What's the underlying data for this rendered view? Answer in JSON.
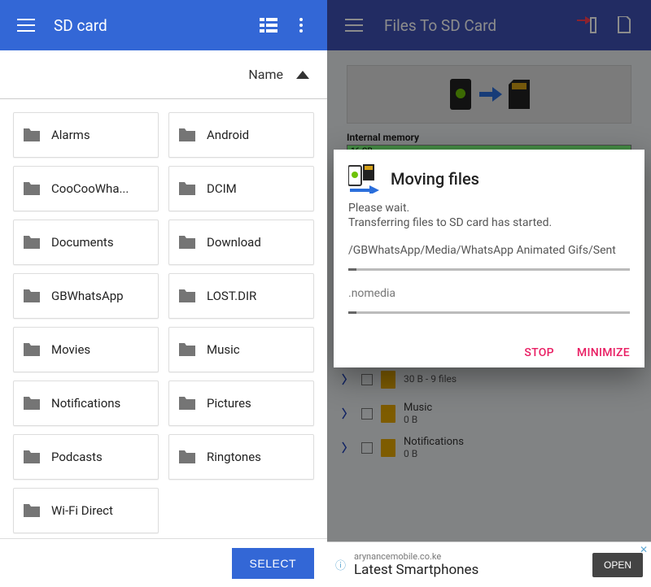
{
  "left": {
    "title": "SD card",
    "sort_label": "Name",
    "select_label": "SELECT",
    "folders": [
      "Alarms",
      "Android",
      "CooCooWha...",
      "DCIM",
      "Documents",
      "Download",
      "GBWhatsApp",
      "LOST.DIR",
      "Movies",
      "Music",
      "Notifications",
      "Pictures",
      "Podcasts",
      "Ringtones",
      "Wi-Fi Direct"
    ]
  },
  "right": {
    "title": "Files To SD Card",
    "internal_label": "Internal memory",
    "internal_value": "16 GB",
    "list": [
      {
        "name": "",
        "sub": "30 B - 9 files"
      },
      {
        "name": "Music",
        "sub": "0 B"
      },
      {
        "name": "Notifications",
        "sub": "0 B"
      }
    ],
    "ad": {
      "url": "arynancemobile.co.ke",
      "title": "Latest Smartphones",
      "cta": "OPEN",
      "close": "✕"
    },
    "dialog": {
      "title": "Moving files",
      "line1": "Please wait.",
      "line2": "Transferring files to SD card has started.",
      "path": "/GBWhatsApp/Media/WhatsApp Animated Gifs/Sent",
      "file": ".nomedia",
      "stop": "STOP",
      "minimize": "MINIMIZE"
    }
  }
}
